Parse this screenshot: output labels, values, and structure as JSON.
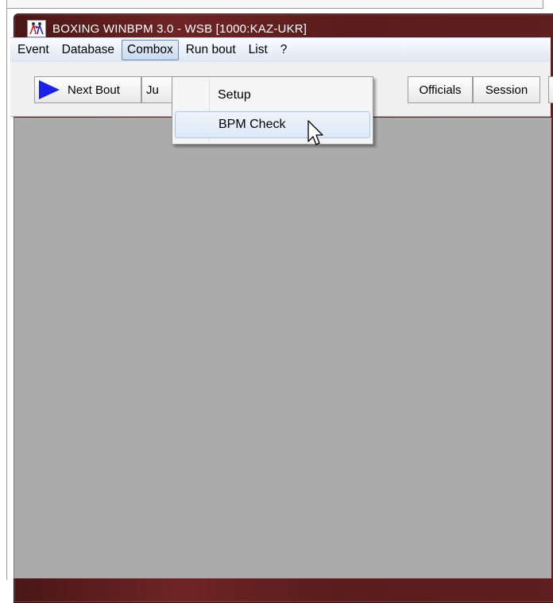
{
  "window": {
    "title": "BOXING WINBPM 3.0 - WSB [1000:KAZ-UKR]",
    "icon": "boxers-icon"
  },
  "menubar": {
    "items": [
      "Event",
      "Database",
      "Combox",
      "Run bout",
      "List",
      "?"
    ],
    "active": "Combox"
  },
  "toolbar": {
    "next_bout": "Next Bout",
    "judges_partial": "Ju",
    "officials": "Officials",
    "session": "Session"
  },
  "dropdown": {
    "items": [
      "Setup",
      "BPM Check"
    ],
    "highlighted": "BPM Check"
  },
  "colors": {
    "titlebar": "#5e1f1f",
    "workspace": "#ababab",
    "play_icon": "#1a22e8"
  }
}
